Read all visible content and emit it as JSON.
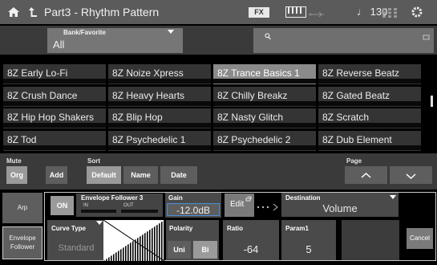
{
  "topbar": {
    "home_icon": "home-icon",
    "back_icon": "back-arrow-icon",
    "title": "Part3 - Rhythm Pattern",
    "fx": "FX",
    "keyboard_icon": "keyboard-icon",
    "usb_icon": "usb-icon",
    "tempo": "♩ 130",
    "grid_icon": "grid-icon",
    "settings_icon": "gear-icon"
  },
  "search": {
    "bank_label": "Bank/Favorite",
    "bank_value": "All",
    "search_icon": "search-icon"
  },
  "grid": [
    [
      "8Z Early Lo-Fi",
      "8Z Noize Xpress",
      "8Z Trance Basics 1",
      "8Z Reverse Beatz"
    ],
    [
      "8Z Crush Dance",
      "8Z Heavy Hearts",
      "8Z Chilly Breakz",
      "8Z Gated Beatz"
    ],
    [
      "8Z Hip Hop Shakers",
      "8Z Blip Hop",
      "8Z Nasty Glitch",
      "8Z Scratch"
    ],
    [
      "8Z Tod",
      "8Z Psychedelic 1",
      "8Z Psychedelic 2",
      "8Z Dub Element"
    ]
  ],
  "selected": "8Z Trance Basics 1",
  "controls": {
    "mute_label": "Mute",
    "mute_org": "Org",
    "mute_add": "Add",
    "sort_label": "Sort",
    "sort_default": "Default",
    "sort_name": "Name",
    "sort_date": "Date",
    "page_label": "Page"
  },
  "bottom": {
    "arp": "Arp",
    "envelope_follower": [
      "Envelope",
      "Follower"
    ],
    "on": "ON",
    "ef_name": "Envelope Follower 3",
    "ef_in": "IN",
    "ef_out": "OUT",
    "gain_label": "Gain",
    "gain_value": "-12.0dB",
    "edit": "Edit",
    "destination_label": "Destination",
    "destination_value": "Volume",
    "curve_label": "Curve Type",
    "curve_value": "Standard",
    "polarity_label": "Polarity",
    "polarity_uni": "Uni",
    "polarity_bi": "Bi",
    "ratio_label": "Ratio",
    "ratio_value": "-64",
    "param1_label": "Param1",
    "param1_value": "5",
    "cancel": "Cancel"
  },
  "colors": {
    "accent_blue": "#4a8fd8",
    "selected_cell": "#8a8a8a"
  }
}
